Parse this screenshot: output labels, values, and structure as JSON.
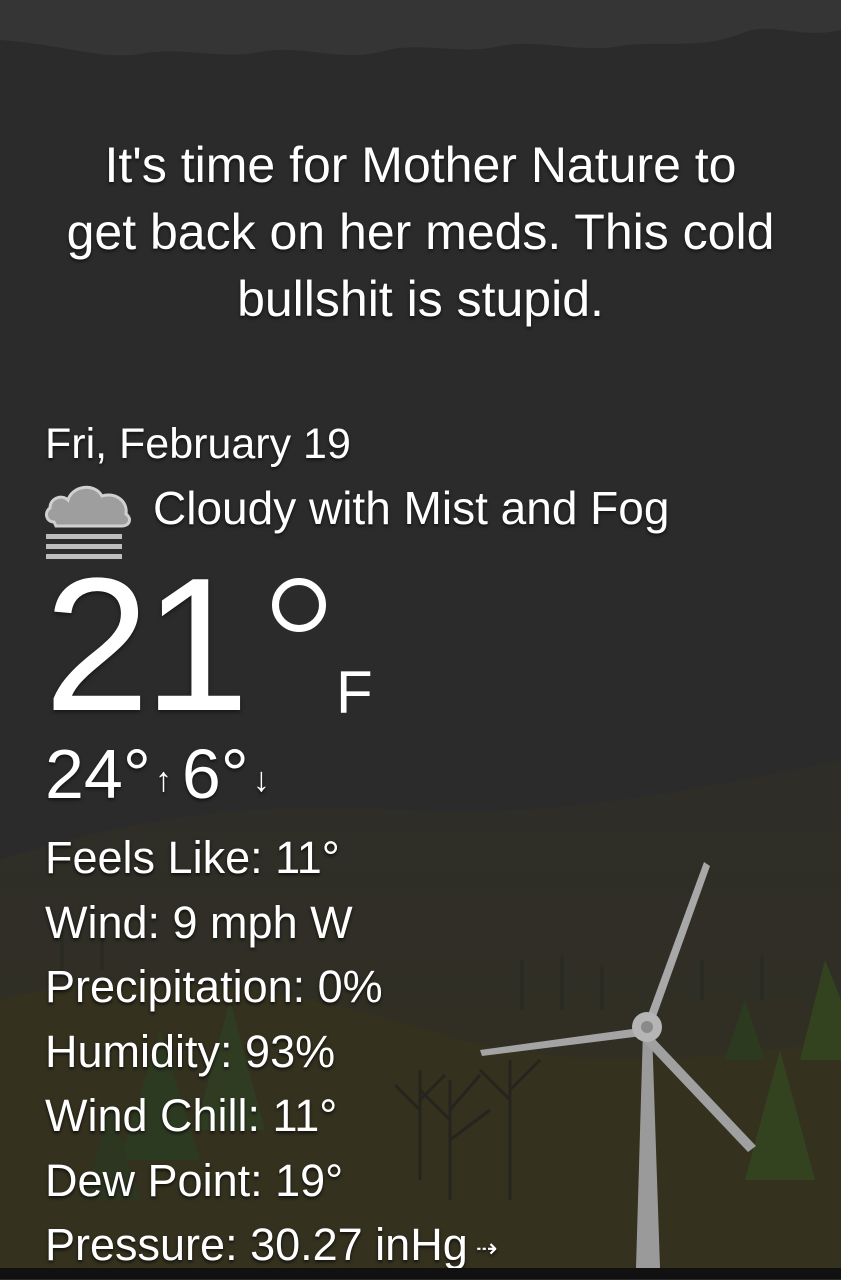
{
  "quote": {
    "line1": "It's time for Mother Nature to",
    "line2": "get back on her meds. This cold",
    "line3": "bullshit is stupid."
  },
  "date": "Fri, February 19",
  "condition": {
    "text": "Cloudy with Mist and Fog",
    "icon": "cloud-fog-icon"
  },
  "temperature": {
    "value": "21",
    "unit": "F"
  },
  "high_low": {
    "high": "24°",
    "high_arrow": "↑",
    "low": "6°",
    "low_arrow": "↓"
  },
  "details": {
    "feels_like": "Feels Like: 11°",
    "wind": "Wind: 9 mph W",
    "precipitation": "Precipitation: 0%",
    "humidity": "Humidity: 93%",
    "wind_chill": "Wind Chill: 11°",
    "dew_point": "Dew Point: 19°",
    "pressure": "Pressure: 30.27 inHg",
    "pressure_trend": "⇢"
  },
  "colors": {
    "sky": "#2b2b2b",
    "ground": "#33301f",
    "tree_green": "#2f3a20",
    "text": "#ffffff",
    "turbine": "#9a9a9a"
  }
}
